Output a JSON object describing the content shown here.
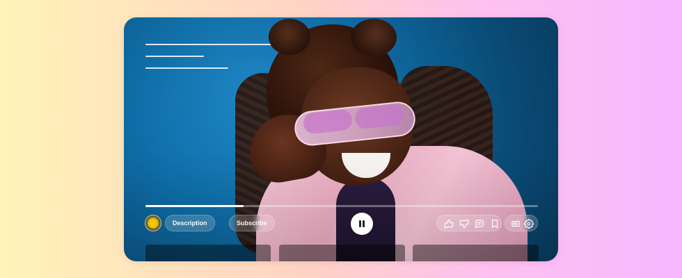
{
  "player": {
    "progress_fraction": 0.25,
    "channel": {
      "avatar_icon": "channel-avatar"
    },
    "buttons": {
      "description": "Description",
      "subscribe": "Subscribe"
    },
    "icons": {
      "play_pause": "pause-icon",
      "like": "thumbs-up-icon",
      "dislike": "thumbs-down-icon",
      "comments": "comment-icon",
      "save": "bookmark-icon",
      "captions": "closed-captions-icon",
      "settings": "gear-icon"
    },
    "colors": {
      "background_gradient_left": "#fff3b8",
      "background_gradient_right": "#f7b7ff",
      "video_bg": "#0f6fa9"
    }
  }
}
